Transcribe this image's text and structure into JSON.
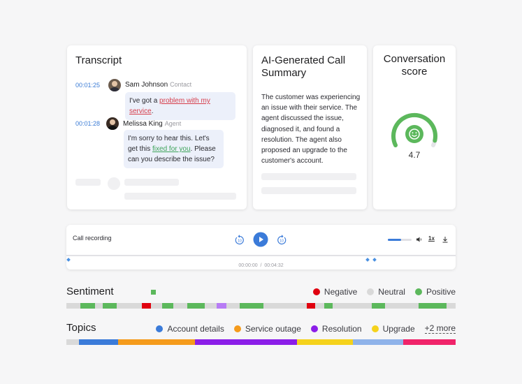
{
  "transcript": {
    "title": "Transcript",
    "messages": [
      {
        "time": "00:01:25",
        "speaker": "Sam Johnson",
        "role": "Contact",
        "text_before": "I've got a ",
        "highlight": "problem with my service",
        "text_after": "."
      },
      {
        "time": "00:01:28",
        "speaker": "Melissa King",
        "role": "Agent",
        "text_before": "I'm sorry to hear this. Let's get this ",
        "highlight": "fixed for you",
        "text_after": ". Please can you describe the issue?"
      }
    ]
  },
  "summary": {
    "title": "AI-Generated Call Summary",
    "text": "The customer was experiencing an issue with their service. The agent discussed the issue, diagnosed it, and found a resolution. The agent also proposed an upgrade to the customer's account."
  },
  "score": {
    "title": "Conversation score",
    "value": "4.7",
    "value_fraction": 0.94,
    "icon": "smile-icon"
  },
  "player": {
    "label": "Call recording",
    "rewind_label": "10",
    "forward_label": "10",
    "speed": "1x",
    "current_time": "00:00:00",
    "separator": "/",
    "total_time": "00:04:32",
    "volume_fraction": 0.55
  },
  "sentiment": {
    "title": "Sentiment",
    "legend": [
      {
        "label": "Negative",
        "color": "#e0000f"
      },
      {
        "label": "Neutral",
        "color": "#d9d9d9"
      },
      {
        "label": "Positive",
        "color": "#5cb85c"
      }
    ]
  },
  "topics": {
    "title": "Topics",
    "legend": [
      {
        "label": "Account details",
        "color": "#3b7bd9"
      },
      {
        "label": "Service outage",
        "color": "#f59b1c"
      },
      {
        "label": "Resolution",
        "color": "#8b1ee8"
      },
      {
        "label": "Upgrade",
        "color": "#f5d21c"
      }
    ],
    "more": "+2 more"
  },
  "colors": {
    "accent": "#3b7bd9",
    "positive": "#5cb85c",
    "negative": "#e0000f",
    "neutral": "#d9d9d9"
  }
}
